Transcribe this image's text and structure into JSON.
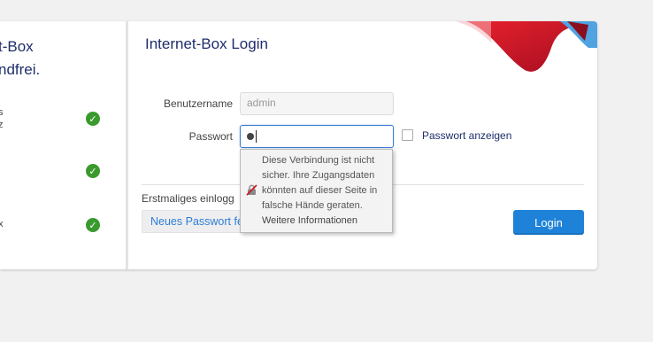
{
  "sidebar": {
    "heading_line1": "t-Box",
    "heading_line2": "ndfrei.",
    "features": [
      {
        "text_line1": "s",
        "text_line2": "z"
      },
      {
        "text_line1": "",
        "text_line2": ""
      },
      {
        "text_line1": "x",
        "text_line2": ""
      }
    ]
  },
  "login_form": {
    "title": "Internet-Box Login",
    "username_label": "Benutzername",
    "username_value": "admin",
    "password_label": "Passwort",
    "show_password_label": "Passwort anzeigen",
    "first_login_text": "Erstmaliges einlogg",
    "new_password_button": "Neues Passwort festlegen",
    "login_button": "Login"
  },
  "security_tooltip": {
    "line1": "Diese Verbindung ist nicht",
    "line2": "sicher. Ihre Zugangsdaten",
    "line3": "könnten auf dieser Seite in",
    "line4": "falsche Hände geraten.",
    "link": "Weitere Informationen"
  },
  "colors": {
    "brand_red": "#d0131f",
    "accent_blue": "#1e82d9",
    "title_navy": "#1f2d6b",
    "check_green": "#3b9a2e"
  }
}
